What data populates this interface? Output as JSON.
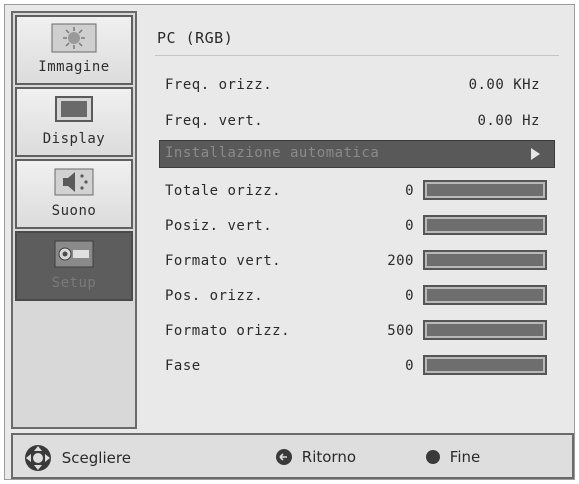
{
  "sidebar": {
    "items": [
      {
        "label": "Immagine",
        "icon": "picture-icon"
      },
      {
        "label": "Display",
        "icon": "monitor-icon"
      },
      {
        "label": "Suono",
        "icon": "speaker-icon"
      },
      {
        "label": "Setup",
        "icon": "projector-icon",
        "active": true
      }
    ]
  },
  "main": {
    "title": "PC (RGB)",
    "info": [
      {
        "label": "Freq. orizz.",
        "value": "0.00 KHz"
      },
      {
        "label": "Freq. vert.",
        "value": "0.00 Hz"
      }
    ],
    "auto_setup_label": "Installazione automatica",
    "sliders": [
      {
        "label": "Totale orizz.",
        "value": "0"
      },
      {
        "label": "Posiz. vert.",
        "value": "0"
      },
      {
        "label": "Formato vert.",
        "value": "200"
      },
      {
        "label": "Pos. orizz.",
        "value": "0"
      },
      {
        "label": "Formato orizz.",
        "value": "500"
      },
      {
        "label": "Fase",
        "value": "0"
      }
    ]
  },
  "footer": {
    "choose_label": "Scegliere",
    "back_label": "Ritorno",
    "end_label": "Fine"
  },
  "colors": {
    "highlight": "#595959",
    "panel": "#e9e9e9",
    "border": "#6a6a6a"
  }
}
